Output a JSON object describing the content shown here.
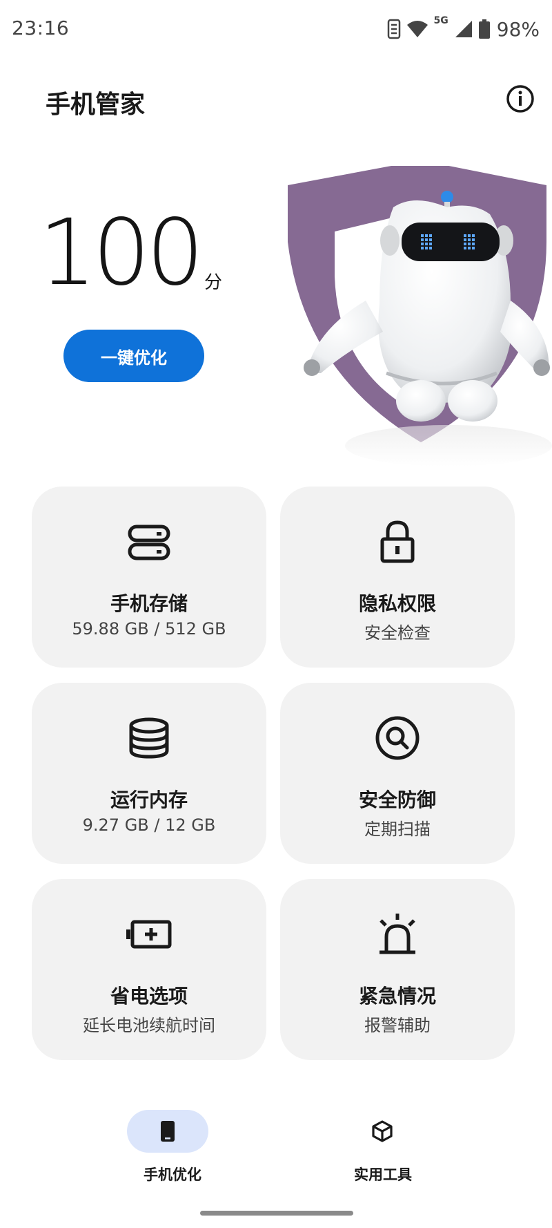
{
  "status_bar": {
    "time": "23:16",
    "network": "5G",
    "battery": "98%"
  },
  "header": {
    "title": "手机管家"
  },
  "score": {
    "value": "100",
    "unit": "分",
    "optimize_label": "一键优化"
  },
  "colors": {
    "accent": "#0f72d9",
    "shield": "#866a93",
    "card_bg": "#f2f2f2",
    "nav_active": "#dbe5fb"
  },
  "cards": [
    {
      "icon": "storage-icon",
      "title": "手机存储",
      "subtitle": "59.88 GB / 512 GB"
    },
    {
      "icon": "lock-icon",
      "title": "隐私权限",
      "subtitle": "安全检查"
    },
    {
      "icon": "memory-icon",
      "title": "运行内存",
      "subtitle": "9.27 GB / 12 GB"
    },
    {
      "icon": "scan-icon",
      "title": "安全防御",
      "subtitle": "定期扫描"
    },
    {
      "icon": "battery-plus-icon",
      "title": "省电选项",
      "subtitle": "延长电池续航时间"
    },
    {
      "icon": "alarm-icon",
      "title": "紧急情况",
      "subtitle": "报警辅助"
    }
  ],
  "bottom_nav": [
    {
      "icon": "phone-icon",
      "label": "手机优化",
      "active": true
    },
    {
      "icon": "tools-icon",
      "label": "实用工具",
      "active": false
    }
  ]
}
